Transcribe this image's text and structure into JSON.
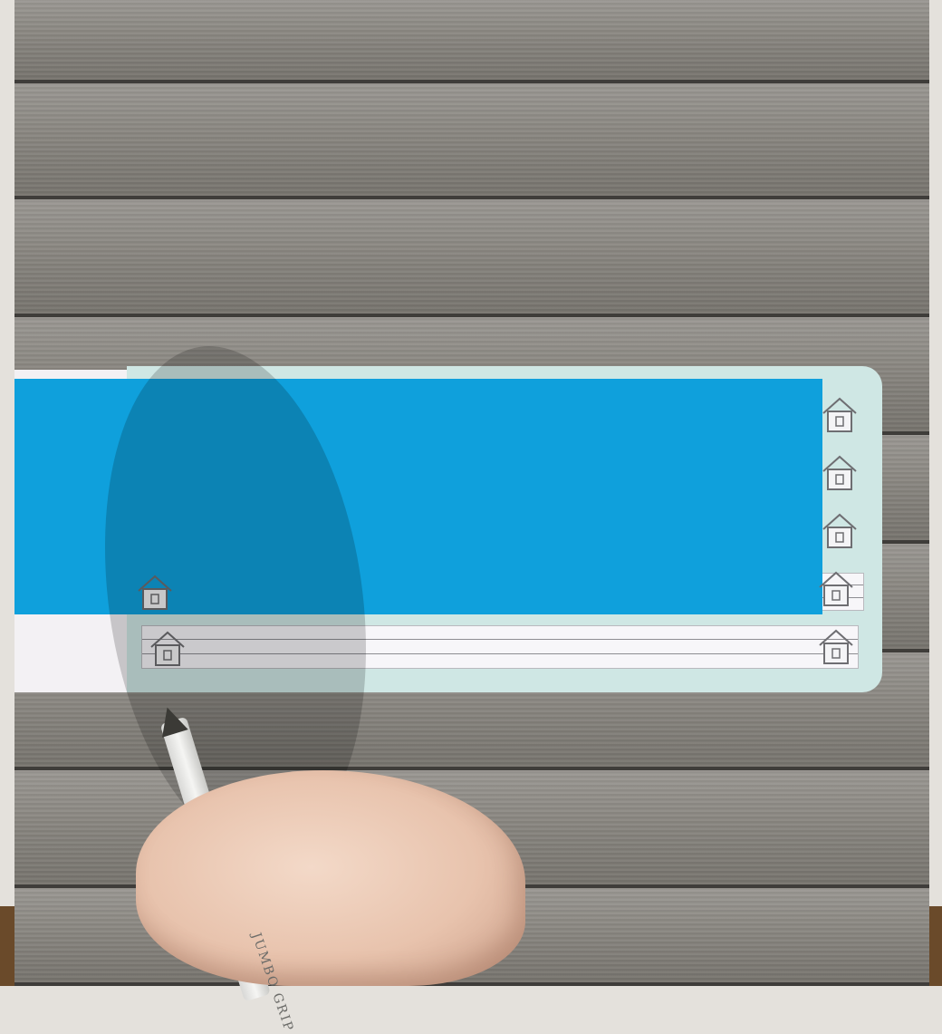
{
  "scene": {
    "description_free": true,
    "colors": {
      "background": "#e4e1dc",
      "wood": "#85827c",
      "blue_flap": "#0fa0dc",
      "mint_page": "#cfe7e4",
      "white_page": "#f3f1f4"
    },
    "icons": [
      "house-icon"
    ],
    "pencil_print": "JUMBO GRIP"
  }
}
